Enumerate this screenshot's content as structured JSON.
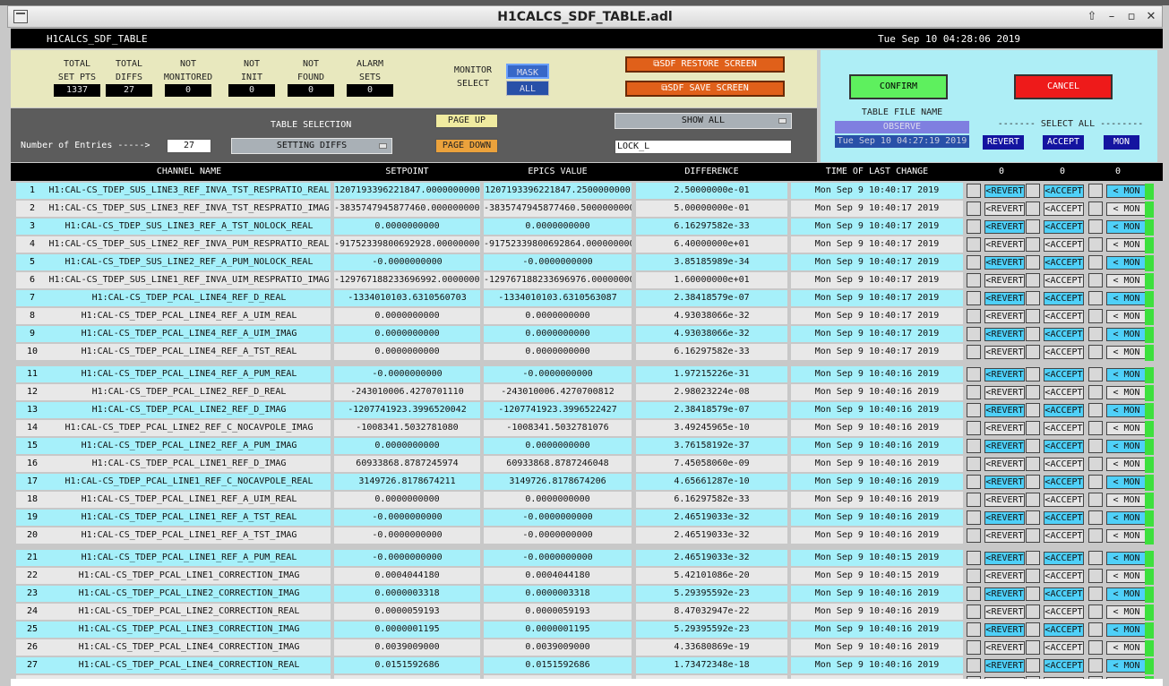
{
  "window": {
    "title": "H1CALCS_SDF_TABLE.adl"
  },
  "topbar": {
    "screen_name": "H1CALCS_SDF_TABLE",
    "datetime": "Tue Sep 10 04:28:06 2019"
  },
  "stats": [
    {
      "label1": "TOTAL",
      "label2": "SET PTS",
      "value": "1337"
    },
    {
      "label1": "TOTAL",
      "label2": "DIFFS",
      "value": "27"
    },
    {
      "label1": "NOT",
      "label2": "MONITORED",
      "value": "0"
    },
    {
      "label1": "NOT",
      "label2": "INIT",
      "value": "0"
    },
    {
      "label1": "NOT",
      "label2": "FOUND",
      "value": "0"
    },
    {
      "label1": "ALARM",
      "label2": "SETS",
      "value": "0"
    }
  ],
  "monitor": {
    "label1": "MONITOR",
    "label2": "SELECT",
    "mask": "MASK",
    "all": "ALL"
  },
  "actions": {
    "restore": "SDF RESTORE SCREEN",
    "save": "SDF SAVE SCREEN"
  },
  "confirm": {
    "confirm": "CONFIRM",
    "cancel": "CANCEL",
    "table_file_label": "TABLE FILE NAME",
    "table_file": "OBSERVE",
    "file_time": "Tue Sep 10 04:27:19 2019",
    "select_all": "------- SELECT ALL --------",
    "revert": "REVERT",
    "accept": "ACCEPT",
    "mon": "MON"
  },
  "tablesel": {
    "entries_label": "Number of Entries ----->",
    "entries": "27",
    "table_selection": "TABLE SELECTION",
    "selection": "SETTING DIFFS",
    "page_up": "PAGE UP",
    "page_down": "PAGE DOWN",
    "show_all": "SHOW ALL",
    "filter": "LOCK_L"
  },
  "columns": {
    "channel": "CHANNEL NAME",
    "setpoint": "SETPOINT",
    "epics": "EPICS VALUE",
    "difference": "DIFFERENCE",
    "time": "TIME OF LAST CHANGE",
    "c1": "0",
    "c2": "0",
    "c3": "0"
  },
  "buttons": {
    "revert": "<REVERT",
    "accept": "<ACCEPT",
    "mon": "< MON"
  },
  "rows": [
    {
      "n": "1",
      "ch": "H1:CAL-CS_TDEP_SUS_LINE3_REF_INVA_TST_RESPRATIO_REAL",
      "sp": "1207193396221847.0000000000",
      "ev": "1207193396221847.2500000000",
      "df": "2.50000000e-01",
      "tm": "Mon Sep  9 10:40:17 2019"
    },
    {
      "n": "2",
      "ch": "H1:CAL-CS_TDEP_SUS_LINE3_REF_INVA_TST_RESPRATIO_IMAG",
      "sp": "-3835747945877460.0000000000",
      "ev": "-3835747945877460.5000000000",
      "df": "5.00000000e-01",
      "tm": "Mon Sep  9 10:40:17 2019"
    },
    {
      "n": "3",
      "ch": "H1:CAL-CS_TDEP_SUS_LINE3_REF_A_TST_NOLOCK_REAL",
      "sp": "0.0000000000",
      "ev": "0.0000000000",
      "df": "6.16297582e-33",
      "tm": "Mon Sep  9 10:40:17 2019"
    },
    {
      "n": "4",
      "ch": "H1:CAL-CS_TDEP_SUS_LINE2_REF_INVA_PUM_RESPRATIO_REAL",
      "sp": "-91752339800692928.0000000000",
      "ev": "-91752339800692864.0000000000",
      "df": "6.40000000e+01",
      "tm": "Mon Sep  9 10:40:17 2019"
    },
    {
      "n": "5",
      "ch": "H1:CAL-CS_TDEP_SUS_LINE2_REF_A_PUM_NOLOCK_REAL",
      "sp": "-0.0000000000",
      "ev": "-0.0000000000",
      "df": "3.85185989e-34",
      "tm": "Mon Sep  9 10:40:17 2019"
    },
    {
      "n": "6",
      "ch": "H1:CAL-CS_TDEP_SUS_LINE1_REF_INVA_UIM_RESPRATIO_IMAG",
      "sp": "-129767188233696992.0000000000",
      "ev": "-129767188233696976.0000000000",
      "df": "1.60000000e+01",
      "tm": "Mon Sep  9 10:40:17 2019"
    },
    {
      "n": "7",
      "ch": "H1:CAL-CS_TDEP_PCAL_LINE4_REF_D_REAL",
      "sp": "-1334010103.6310560703",
      "ev": "-1334010103.6310563087",
      "df": "2.38418579e-07",
      "tm": "Mon Sep  9 10:40:17 2019"
    },
    {
      "n": "8",
      "ch": "H1:CAL-CS_TDEP_PCAL_LINE4_REF_A_UIM_REAL",
      "sp": "0.0000000000",
      "ev": "0.0000000000",
      "df": "4.93038066e-32",
      "tm": "Mon Sep  9 10:40:17 2019"
    },
    {
      "n": "9",
      "ch": "H1:CAL-CS_TDEP_PCAL_LINE4_REF_A_UIM_IMAG",
      "sp": "0.0000000000",
      "ev": "0.0000000000",
      "df": "4.93038066e-32",
      "tm": "Mon Sep  9 10:40:17 2019"
    },
    {
      "n": "10",
      "ch": "H1:CAL-CS_TDEP_PCAL_LINE4_REF_A_TST_REAL",
      "sp": "0.0000000000",
      "ev": "0.0000000000",
      "df": "6.16297582e-33",
      "tm": "Mon Sep  9 10:40:17 2019"
    },
    {
      "n": "11",
      "ch": "H1:CAL-CS_TDEP_PCAL_LINE4_REF_A_PUM_REAL",
      "sp": "-0.0000000000",
      "ev": "-0.0000000000",
      "df": "1.97215226e-31",
      "tm": "Mon Sep  9 10:40:16 2019"
    },
    {
      "n": "12",
      "ch": "H1:CAL-CS_TDEP_PCAL_LINE2_REF_D_REAL",
      "sp": "-243010006.4270701110",
      "ev": "-243010006.4270700812",
      "df": "2.98023224e-08",
      "tm": "Mon Sep  9 10:40:16 2019"
    },
    {
      "n": "13",
      "ch": "H1:CAL-CS_TDEP_PCAL_LINE2_REF_D_IMAG",
      "sp": "-1207741923.3996520042",
      "ev": "-1207741923.3996522427",
      "df": "2.38418579e-07",
      "tm": "Mon Sep  9 10:40:16 2019"
    },
    {
      "n": "14",
      "ch": "H1:CAL-CS_TDEP_PCAL_LINE2_REF_C_NOCAVPOLE_IMAG",
      "sp": "-1008341.5032781080",
      "ev": "-1008341.5032781076",
      "df": "3.49245965e-10",
      "tm": "Mon Sep  9 10:40:16 2019"
    },
    {
      "n": "15",
      "ch": "H1:CAL-CS_TDEP_PCAL_LINE2_REF_A_PUM_IMAG",
      "sp": "0.0000000000",
      "ev": "0.0000000000",
      "df": "3.76158192e-37",
      "tm": "Mon Sep  9 10:40:16 2019"
    },
    {
      "n": "16",
      "ch": "H1:CAL-CS_TDEP_PCAL_LINE1_REF_D_IMAG",
      "sp": "60933868.8787245974",
      "ev": "60933868.8787246048",
      "df": "7.45058060e-09",
      "tm": "Mon Sep  9 10:40:16 2019"
    },
    {
      "n": "17",
      "ch": "H1:CAL-CS_TDEP_PCAL_LINE1_REF_C_NOCAVPOLE_REAL",
      "sp": "3149726.8178674211",
      "ev": "3149726.8178674206",
      "df": "4.65661287e-10",
      "tm": "Mon Sep  9 10:40:16 2019"
    },
    {
      "n": "18",
      "ch": "H1:CAL-CS_TDEP_PCAL_LINE1_REF_A_UIM_REAL",
      "sp": "0.0000000000",
      "ev": "0.0000000000",
      "df": "6.16297582e-33",
      "tm": "Mon Sep  9 10:40:16 2019"
    },
    {
      "n": "19",
      "ch": "H1:CAL-CS_TDEP_PCAL_LINE1_REF_A_TST_REAL",
      "sp": "-0.0000000000",
      "ev": "-0.0000000000",
      "df": "2.46519033e-32",
      "tm": "Mon Sep  9 10:40:16 2019"
    },
    {
      "n": "20",
      "ch": "H1:CAL-CS_TDEP_PCAL_LINE1_REF_A_TST_IMAG",
      "sp": "-0.0000000000",
      "ev": "-0.0000000000",
      "df": "2.46519033e-32",
      "tm": "Mon Sep  9 10:40:16 2019"
    },
    {
      "n": "21",
      "ch": "H1:CAL-CS_TDEP_PCAL_LINE1_REF_A_PUM_REAL",
      "sp": "-0.0000000000",
      "ev": "-0.0000000000",
      "df": "2.46519033e-32",
      "tm": "Mon Sep  9 10:40:15 2019"
    },
    {
      "n": "22",
      "ch": "H1:CAL-CS_TDEP_PCAL_LINE1_CORRECTION_IMAG",
      "sp": "0.0004044180",
      "ev": "0.0004044180",
      "df": "5.42101086e-20",
      "tm": "Mon Sep  9 10:40:15 2019"
    },
    {
      "n": "23",
      "ch": "H1:CAL-CS_TDEP_PCAL_LINE2_CORRECTION_IMAG",
      "sp": "0.0000003318",
      "ev": "0.0000003318",
      "df": "5.29395592e-23",
      "tm": "Mon Sep  9 10:40:16 2019"
    },
    {
      "n": "24",
      "ch": "H1:CAL-CS_TDEP_PCAL_LINE2_CORRECTION_REAL",
      "sp": "0.0000059193",
      "ev": "0.0000059193",
      "df": "8.47032947e-22",
      "tm": "Mon Sep  9 10:40:16 2019"
    },
    {
      "n": "25",
      "ch": "H1:CAL-CS_TDEP_PCAL_LINE3_CORRECTION_IMAG",
      "sp": "0.0000001195",
      "ev": "0.0000001195",
      "df": "5.29395592e-23",
      "tm": "Mon Sep  9 10:40:16 2019"
    },
    {
      "n": "26",
      "ch": "H1:CAL-CS_TDEP_PCAL_LINE4_CORRECTION_IMAG",
      "sp": "0.0039009000",
      "ev": "0.0039009000",
      "df": "4.33680869e-19",
      "tm": "Mon Sep  9 10:40:16 2019"
    },
    {
      "n": "27",
      "ch": "H1:CAL-CS_TDEP_PCAL_LINE4_CORRECTION_REAL",
      "sp": "0.0151592686",
      "ev": "0.0151592686",
      "df": "1.73472348e-18",
      "tm": "Mon Sep  9 10:40:16 2019"
    },
    {
      "n": "28",
      "ch": "",
      "sp": "",
      "ev": "",
      "df": "",
      "tm": ""
    }
  ]
}
